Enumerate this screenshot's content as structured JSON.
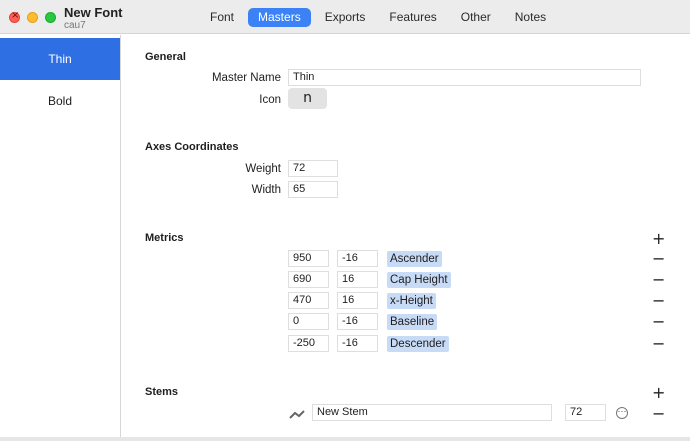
{
  "window": {
    "title": "New Font",
    "subtitle": "cau7"
  },
  "tabs": [
    "Font",
    "Masters",
    "Exports",
    "Features",
    "Other",
    "Notes"
  ],
  "active_tab": "Masters",
  "masters": [
    "Thin",
    "Bold"
  ],
  "selected_master": "Thin",
  "general": {
    "title": "General",
    "master_name_label": "Master Name",
    "master_name_value": "Thin",
    "icon_label": "Icon",
    "icon_glyph": "n"
  },
  "axes": {
    "title": "Axes Coordinates",
    "weight_label": "Weight",
    "weight_value": "72",
    "width_label": "Width",
    "width_value": "65"
  },
  "metrics": {
    "title": "Metrics",
    "add": "+",
    "remove": "−",
    "rows": [
      {
        "value": "950",
        "overshoot": "-16",
        "name": "Ascender"
      },
      {
        "value": "690",
        "overshoot": "16",
        "name": "Cap Height"
      },
      {
        "value": "470",
        "overshoot": "16",
        "name": "x-Height"
      },
      {
        "value": "0",
        "overshoot": "-16",
        "name": "Baseline"
      },
      {
        "value": "-250",
        "overshoot": "-16",
        "name": "Descender"
      }
    ]
  },
  "stems": {
    "title": "Stems",
    "add": "+",
    "remove": "−",
    "name": "New Stem",
    "value": "72",
    "options": "···"
  }
}
